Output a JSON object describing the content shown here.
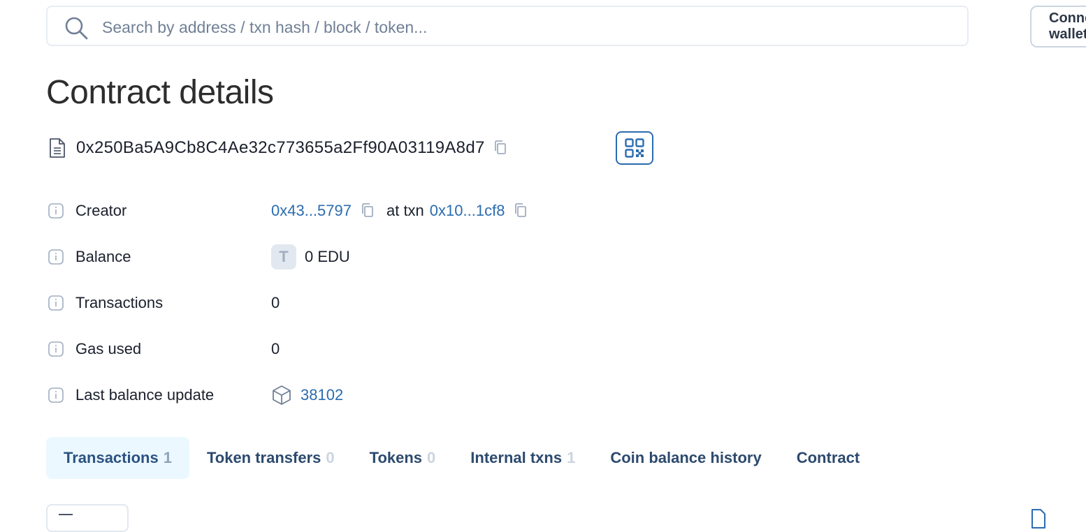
{
  "search": {
    "placeholder": "Search by address / txn hash / block / token..."
  },
  "header": {
    "connect_label": "Connect wallet"
  },
  "page": {
    "title": "Contract details",
    "address": "0x250Ba5A9Cb8C4Ae32c773655a2Ff90A03119A8d7"
  },
  "details": {
    "creator": {
      "label": "Creator",
      "address": "0x43...5797",
      "at_txn_text": "at txn",
      "txn": "0x10...1cf8"
    },
    "balance": {
      "label": "Balance",
      "token_letter": "T",
      "value": "0 EDU"
    },
    "transactions": {
      "label": "Transactions",
      "value": "0"
    },
    "gas_used": {
      "label": "Gas used",
      "value": "0"
    },
    "last_balance_update": {
      "label": "Last balance update",
      "block": "38102"
    }
  },
  "tabs": [
    {
      "label": "Transactions",
      "count": "1",
      "active": true
    },
    {
      "label": "Token transfers",
      "count": "0"
    },
    {
      "label": "Tokens",
      "count": "0"
    },
    {
      "label": "Internal txns",
      "count": "1"
    },
    {
      "label": "Coin balance history",
      "count": ""
    },
    {
      "label": "Contract",
      "count": ""
    }
  ],
  "colors": {
    "link": "#2b6cb0",
    "tab_active_bg": "#ebf8ff",
    "qr_border": "#2b6cb0"
  },
  "icons": [
    "search-icon",
    "contract-file-icon",
    "copy-icon",
    "qr-code-icon",
    "info-icon",
    "cube-block-icon",
    "download-icon"
  ]
}
